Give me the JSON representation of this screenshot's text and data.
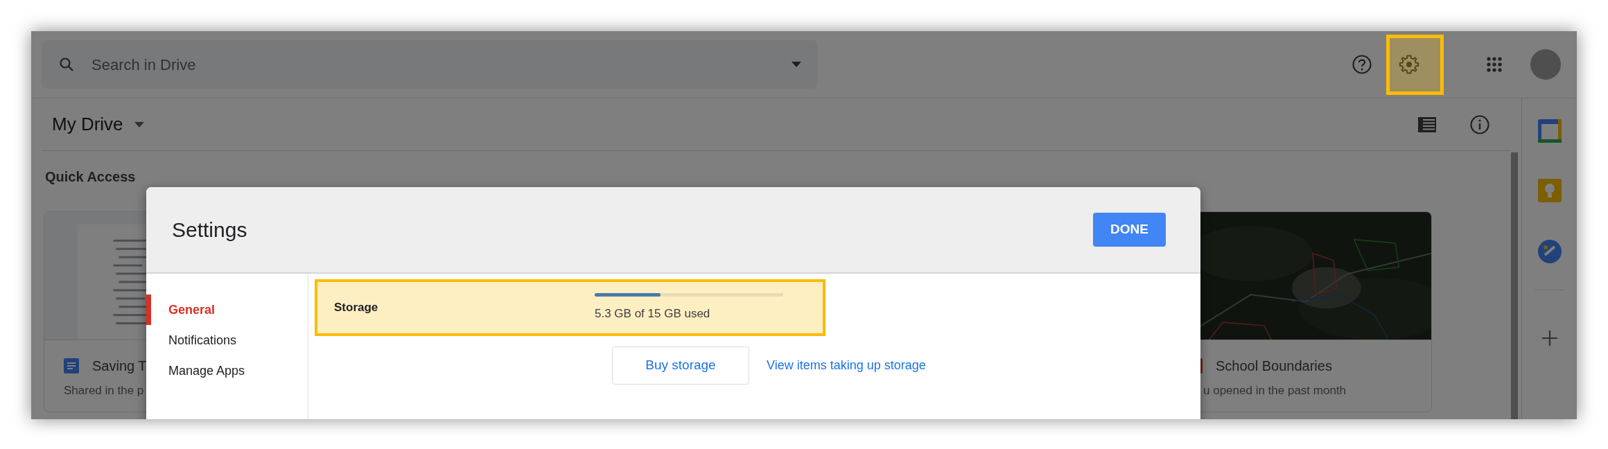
{
  "search": {
    "placeholder": "Search in Drive"
  },
  "settings_highlighted": true,
  "header": {
    "title": "My Drive"
  },
  "section_title": "Quick Access",
  "quick_access": [
    {
      "kind": "document",
      "title": "Saving T",
      "subtitle": "Shared in the p"
    },
    {
      "kind": "map",
      "title": "School Boundaries",
      "subtitle": "u opened in the past month"
    }
  ],
  "dialog": {
    "title": "Settings",
    "done": "DONE",
    "nav": [
      {
        "label": "General",
        "selected": true
      },
      {
        "label": "Notifications",
        "selected": false
      },
      {
        "label": "Manage Apps",
        "selected": false
      }
    ],
    "storage": {
      "label": "Storage",
      "level": 0.35,
      "reading": "5.3 GB of 15 GB used",
      "highlighted": true,
      "buy": "Buy storage",
      "link": "View items taking up storage"
    }
  }
}
